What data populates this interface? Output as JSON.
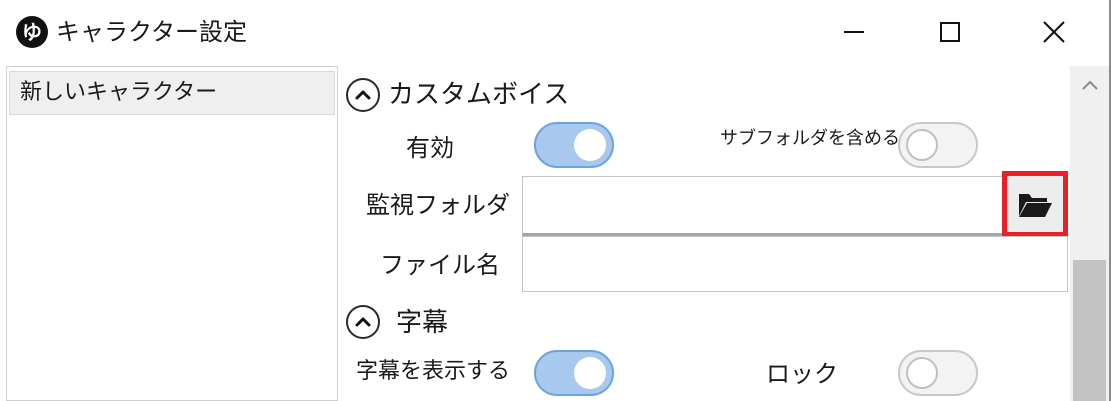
{
  "window": {
    "title": "キャラクター設定",
    "app_icon_glyph": "ゆ"
  },
  "character_list": {
    "items": [
      {
        "label": "新しいキャラクター",
        "selected": true
      }
    ]
  },
  "custom_voice": {
    "section_title": "カスタムボイス",
    "expanded": true,
    "enabled_label": "有効",
    "enabled": true,
    "include_subfolders_label": "サブフォルダを含める",
    "include_subfolders": false,
    "watch_folder_label": "監視フォルダ",
    "watch_folder_value": "",
    "folder_button_icon": "folder-open-icon",
    "file_name_label": "ファイル名",
    "file_name_value": ""
  },
  "subtitle": {
    "section_title": "字幕",
    "expanded": true,
    "show_label": "字幕を表示する",
    "show": true,
    "lock_label": "ロック",
    "lock": false
  },
  "colors": {
    "toggle_on": "#a8c8ee",
    "toggle_on_border": "#6aa3e0",
    "highlight": "#e8202a"
  }
}
